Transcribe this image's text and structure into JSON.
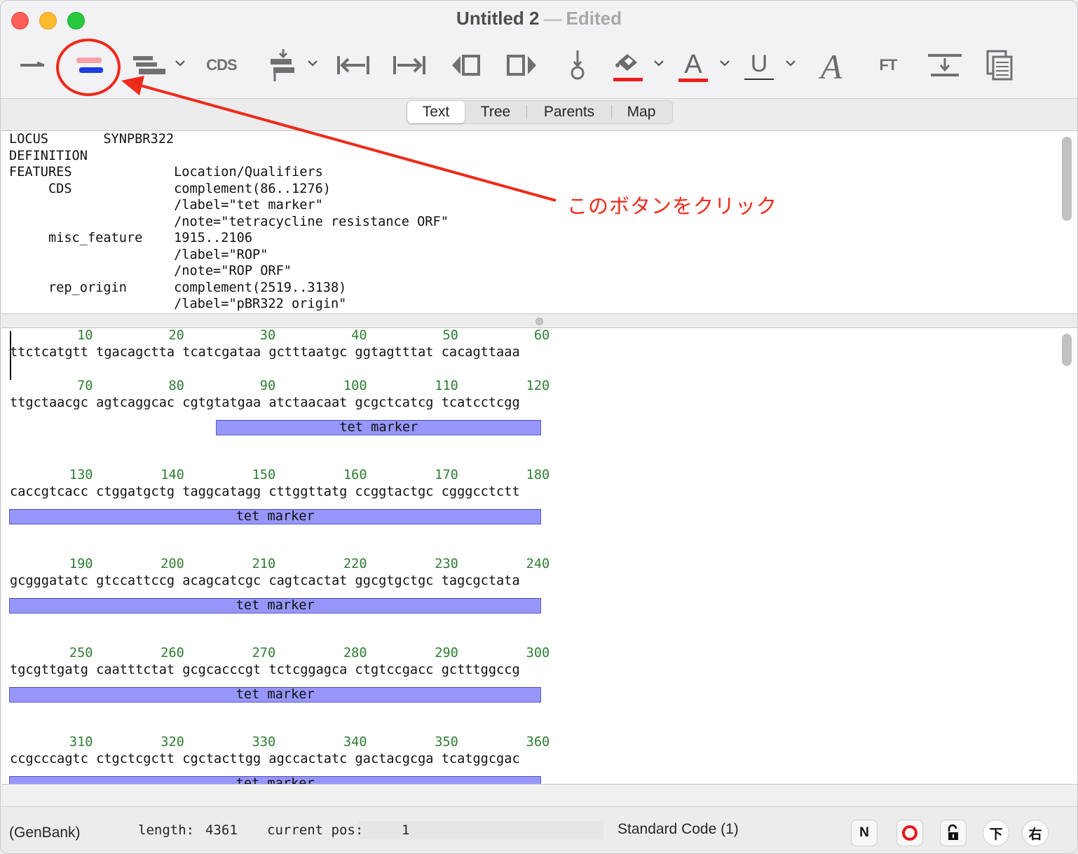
{
  "window": {
    "title": "Untitled 2",
    "separator": "—",
    "edited": "Edited"
  },
  "toolbar": {
    "cds_label": "CDS",
    "ft_label": "FT",
    "color_red": "#ee1c1c"
  },
  "tabs": [
    {
      "label": "Text",
      "active": true
    },
    {
      "label": "Tree",
      "active": false
    },
    {
      "label": "Parents",
      "active": false
    },
    {
      "label": "Map",
      "active": false
    }
  ],
  "header_text": {
    "lines": [
      "LOCUS       SYNPBR322",
      "DEFINITION",
      "FEATURES             Location/Qualifiers",
      "     CDS             complement(86..1276)",
      "                     /label=\"tet marker\"",
      "                     /note=\"tetracycline resistance ORF\"",
      "     misc_feature    1915..2106",
      "                     /label=\"ROP\"",
      "                     /note=\"ROP ORF\"",
      "     rep_origin      complement(2519..3138)",
      "                     /label=\"pBR322 origin\""
    ]
  },
  "sequence": {
    "blocks": [
      {
        "numbers": [
          "10",
          "20",
          "30",
          "40",
          "50",
          "60"
        ],
        "seq": "ttctcatgtt tgacagctta tcatcgataa gctttaatgc ggtagtttat cacagttaaa",
        "feature": ""
      },
      {
        "numbers": [
          "70",
          "80",
          "90",
          "100",
          "110",
          "120"
        ],
        "seq": "ttgctaacgc agtcaggcac cgtgtatgaa atctaacaat gcgctcatcg tcatcctcgg",
        "feature": "tet marker"
      },
      {
        "numbers": [
          "130",
          "140",
          "150",
          "160",
          "170",
          "180"
        ],
        "seq": "caccgtcacc ctggatgctg taggcatagg cttggttatg ccggtactgc cgggcctctt",
        "feature": "tet marker"
      },
      {
        "numbers": [
          "190",
          "200",
          "210",
          "220",
          "230",
          "240"
        ],
        "seq": "gcgggatatc gtccattccg acagcatcgc cagtcactat ggcgtgctgc tagcgctata",
        "feature": "tet marker"
      },
      {
        "numbers": [
          "250",
          "260",
          "270",
          "280",
          "290",
          "300"
        ],
        "seq": "tgcgttgatg caatttctat gcgcacccgt tctcggagca ctgtccgacc gctttggccg",
        "feature": "tet marker"
      },
      {
        "numbers": [
          "310",
          "320",
          "330",
          "340",
          "350",
          "360"
        ],
        "seq": "ccgcccagtc ctgctcgctt cgctacttgg agccactatc gactacgcga tcatggcgac",
        "feature": "tet marker"
      }
    ],
    "number_color": "#2e7d32",
    "feature_color": "#9797fb"
  },
  "status": {
    "format": "(GenBank)",
    "length_label": "length:",
    "length_value": "4361",
    "pos_label": "current pos:",
    "pos_value": "1",
    "code": "Standard Code (1)",
    "buttons": [
      "N",
      "下",
      "右"
    ]
  },
  "annotation": {
    "text": "このボタンをクリック",
    "color": "#ee2a1a"
  }
}
